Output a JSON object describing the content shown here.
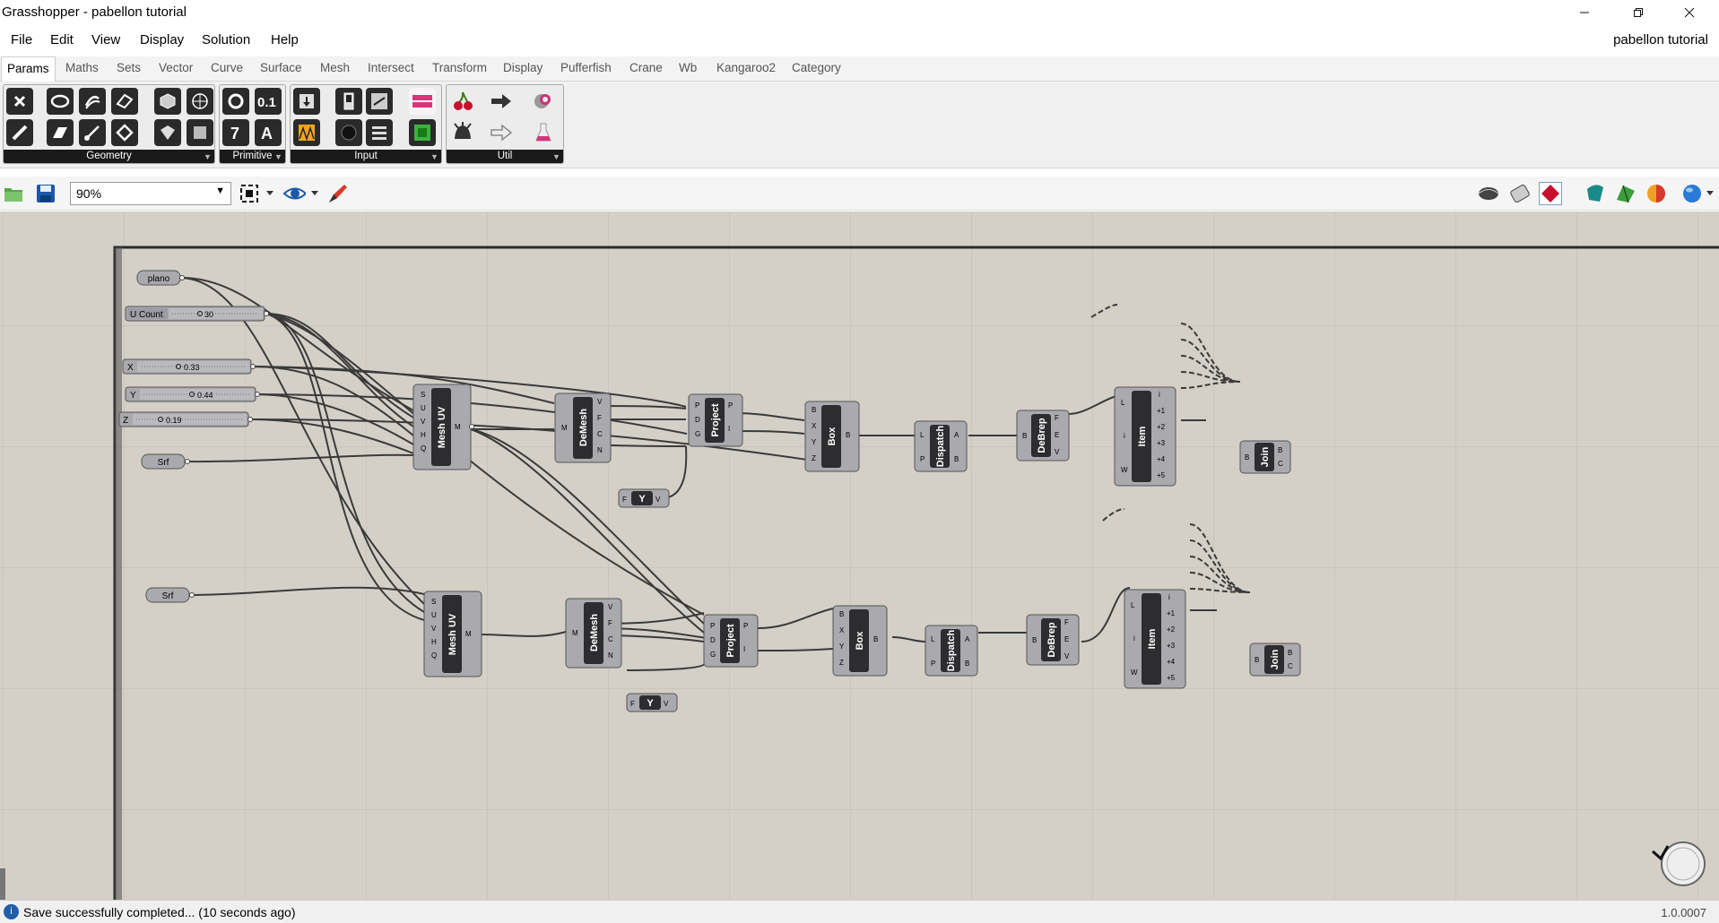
{
  "window": {
    "title": "Grasshopper - pabellon tutorial",
    "document_name": "pabellon tutorial"
  },
  "menu": [
    "File",
    "Edit",
    "View",
    "Display",
    "Solution",
    "Help"
  ],
  "tabs": [
    "Params",
    "Maths",
    "Sets",
    "Vector",
    "Curve",
    "Surface",
    "Mesh",
    "Intersect",
    "Transform",
    "Display",
    "Pufferfish",
    "Crane",
    "Wb",
    "Kangaroo2",
    "Category"
  ],
  "active_tab": "Params",
  "ribbon_panels": [
    "Geometry",
    "Primitive",
    "Input",
    "Util"
  ],
  "toolbar": {
    "zoom": "90%"
  },
  "canvas": {
    "components": {
      "plano": "plano",
      "u_count_label": "U Count",
      "u_count_value": "30",
      "x_label": "X",
      "x_value": "0.33",
      "y_label": "Y",
      "y_value": "0.44",
      "z_label": "Z",
      "z_value": "0.19",
      "srf": "Srf",
      "mesh_uv": "Mesh UV",
      "demesh": "DeMesh",
      "project": "Project",
      "box": "Box",
      "dispatch": "Dispatch",
      "debrep": "DeBrep",
      "item": "Item",
      "join": "Join",
      "expr": "Y",
      "port_s": "S",
      "port_u": "U",
      "port_v": "V",
      "port_h": "H",
      "port_q": "Q",
      "port_m": "M",
      "port_f": "F",
      "port_c": "C",
      "port_n": "N",
      "port_p": "P",
      "port_d": "D",
      "port_g": "G",
      "port_i": "I",
      "port_b": "B",
      "port_x": "X",
      "port_y": "Y",
      "port_z": "Z",
      "port_l": "L",
      "port_a": "A",
      "port_e": "E",
      "port_w": "W",
      "port_i0": "i",
      "port_p1": "+1",
      "port_p2": "+2",
      "port_p3": "+3",
      "port_p4": "+4",
      "port_p5": "+5"
    }
  },
  "status": {
    "message": "Save successfully completed... (10 seconds ago)",
    "version": "1.0.0007"
  },
  "colors": {
    "canvas_bg": "#d4d0c8",
    "component_body": "#a9a9ae",
    "component_core": "#2d2d30",
    "wire": "#3a3a3a"
  }
}
